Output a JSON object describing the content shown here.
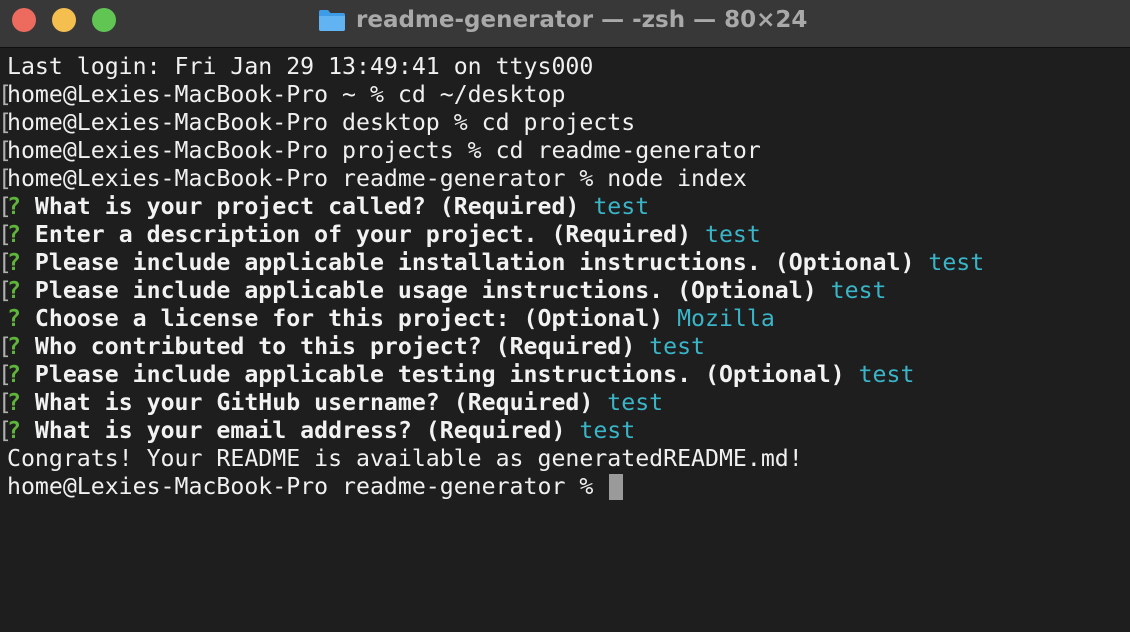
{
  "window": {
    "title": "readme-generator — -zsh — 80×24",
    "folder_icon": "folder-icon",
    "traffic_lights": [
      "close",
      "minimize",
      "zoom"
    ]
  },
  "colors": {
    "background": "#1e1e1e",
    "titlebar": "#383838",
    "prompt_question_mark": "#5fb53c",
    "answer": "#3ab5c8",
    "text": "#f0f0f0"
  },
  "terminal": {
    "last_login": "Last login: Fri Jan 29 13:49:41 on ttys000",
    "commands": [
      "home@Lexies-MacBook-Pro ~ % cd ~/desktop",
      "home@Lexies-MacBook-Pro desktop % cd projects",
      "home@Lexies-MacBook-Pro projects % cd readme-generator",
      "home@Lexies-MacBook-Pro readme-generator % node index"
    ],
    "questions": [
      {
        "mark": "?",
        "text": "What is your project called? (Required)",
        "answer": "test"
      },
      {
        "mark": "?",
        "text": "Enter a description of your project. (Required)",
        "answer": "test"
      },
      {
        "mark": "?",
        "text": "Please include applicable installation instructions. (Optional)",
        "answer": "test"
      },
      {
        "mark": "?",
        "text": "Please include applicable usage instructions. (Optional)",
        "answer": "test"
      },
      {
        "mark": "?",
        "text": "Choose a license for this project: (Optional)",
        "answer": "Mozilla"
      },
      {
        "mark": "?",
        "text": "Who contributed to this project? (Required)",
        "answer": "test"
      },
      {
        "mark": "?",
        "text": "Please include applicable testing instructions. (Optional)",
        "answer": "test"
      },
      {
        "mark": "?",
        "text": "What is your GitHub username? (Required)",
        "answer": "test"
      },
      {
        "mark": "?",
        "text": "What is your email address? (Required)",
        "answer": "test"
      }
    ],
    "congrats": "Congrats! Your README is available as generatedREADME.md!",
    "final_prompt": "home@Lexies-MacBook-Pro readme-generator % "
  }
}
